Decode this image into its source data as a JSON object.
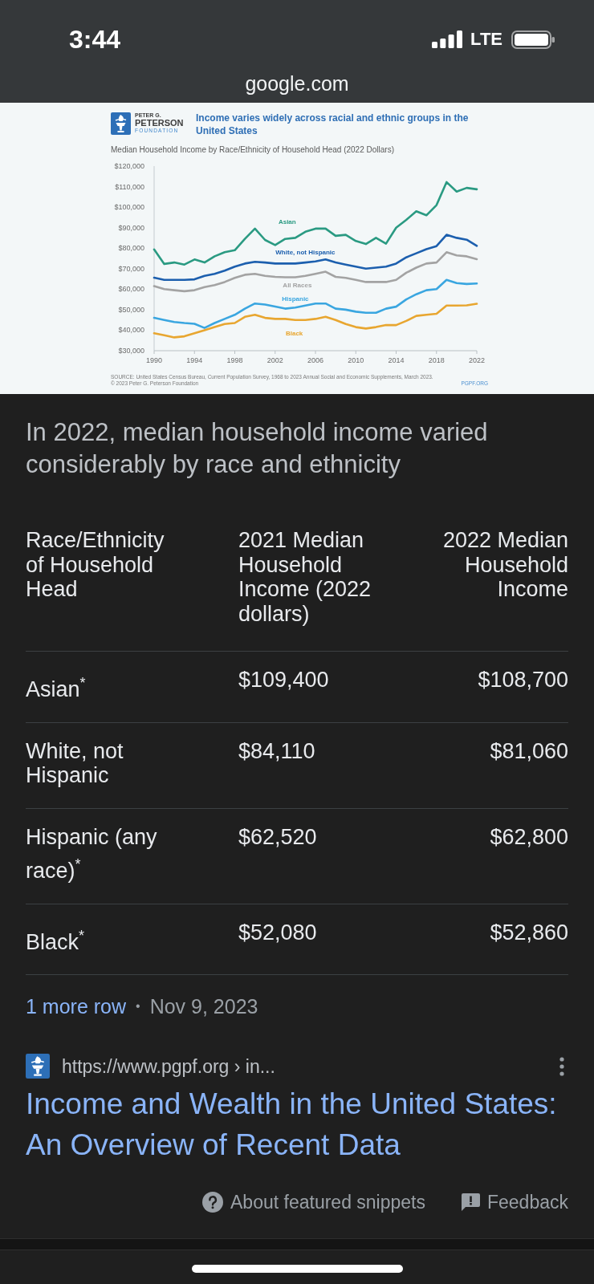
{
  "status_bar": {
    "time": "3:44",
    "network": "LTE"
  },
  "address_bar": {
    "url": "google.com"
  },
  "chart_image": {
    "logo": [
      "PETER G.",
      "PETERSON",
      "FOUNDATION"
    ],
    "subtitle": "Median Household Income by Race/Ethnicity of Household Head (2022 Dollars)",
    "chart_data": {
      "type": "line",
      "title": "Income varies widely across racial and ethnic groups in the United States",
      "x": [
        1990,
        1991,
        1992,
        1993,
        1994,
        1995,
        1996,
        1997,
        1998,
        1999,
        2000,
        2001,
        2002,
        2003,
        2004,
        2005,
        2006,
        2007,
        2008,
        2009,
        2010,
        2011,
        2012,
        2013,
        2014,
        2015,
        2016,
        2017,
        2018,
        2019,
        2020,
        2021,
        2022
      ],
      "series": [
        {
          "name": "Asian",
          "color": "#2a9a82",
          "values": [
            79400,
            72300,
            73000,
            72000,
            74500,
            73000,
            76000,
            78000,
            79000,
            84500,
            89500,
            84000,
            81500,
            84500,
            85000,
            88000,
            89500,
            89500,
            86000,
            86500,
            83500,
            82000,
            85000,
            82200,
            90000,
            93800,
            98000,
            96000,
            101000,
            112200,
            107600,
            109400,
            108700
          ]
        },
        {
          "name": "White, not Hispanic",
          "color": "#1c5fae",
          "values": [
            65600,
            64500,
            64500,
            64500,
            64800,
            66500,
            67500,
            69000,
            71000,
            72500,
            73300,
            73000,
            72500,
            72500,
            72500,
            73000,
            73500,
            74500,
            73000,
            72000,
            71000,
            70000,
            70500,
            71000,
            72500,
            75500,
            77500,
            79500,
            81000,
            86500,
            85000,
            84100,
            81100
          ]
        },
        {
          "name": "All Races",
          "color": "#a3a3a3",
          "values": [
            61500,
            60000,
            59500,
            59000,
            59500,
            61000,
            62000,
            63500,
            65500,
            67000,
            67500,
            66500,
            66000,
            65800,
            65800,
            66500,
            67500,
            68500,
            66000,
            65500,
            64500,
            63500,
            63500,
            63500,
            64500,
            68000,
            70500,
            72500,
            73000,
            78000,
            76500,
            76000,
            74600
          ]
        },
        {
          "name": "Hispanic",
          "color": "#3aa6e0",
          "values": [
            46000,
            45000,
            44000,
            43500,
            43100,
            41100,
            43500,
            45500,
            47500,
            50500,
            53000,
            52500,
            51500,
            50500,
            51000,
            52000,
            53000,
            53000,
            50500,
            50000,
            49000,
            48500,
            48500,
            50500,
            51500,
            55000,
            57500,
            59500,
            60000,
            64500,
            63000,
            62500,
            62800
          ]
        },
        {
          "name": "Black",
          "color": "#e8a630",
          "values": [
            38500,
            37500,
            36500,
            37000,
            38500,
            40000,
            41500,
            43000,
            43500,
            46500,
            47500,
            46000,
            45500,
            45500,
            45000,
            45000,
            45500,
            46500,
            45000,
            43000,
            41500,
            40800,
            41500,
            42500,
            42500,
            44500,
            47000,
            47500,
            48000,
            52000,
            52000,
            52100,
            52900
          ]
        }
      ],
      "xlim": [
        1990,
        2022
      ],
      "ylim": [
        30000,
        120000
      ],
      "xticks": [
        1990,
        1994,
        1998,
        2002,
        2006,
        2010,
        2014,
        2018,
        2022
      ],
      "yticks": [
        {
          "value": 30000,
          "label": "$30,000"
        },
        {
          "value": 40000,
          "label": "$40,000"
        },
        {
          "value": 50000,
          "label": "$50,000"
        },
        {
          "value": 60000,
          "label": "$60,000"
        },
        {
          "value": 70000,
          "label": "$70,000"
        },
        {
          "value": 80000,
          "label": "$80,000"
        },
        {
          "value": 90000,
          "label": "$90,000"
        },
        {
          "value": 100000,
          "label": "$100,000"
        },
        {
          "value": 110000,
          "label": "$110,000"
        },
        {
          "value": 120000,
          "label": "$120,000"
        }
      ]
    },
    "source": "SOURCE: United States Census Bureau, Current Population Survey, 1968 to 2023 Annual Social and Economic Supplements, March 2023.",
    "copyright": "© 2023 Peter G. Peterson Foundation",
    "site": "PGPF.ORG"
  },
  "snippet": {
    "heading": "In 2022, median household income varied considerably by race and ethnicity",
    "table": {
      "columns": [
        "Race/Ethnicity of Household Head",
        "2021 Median Household Income (2022 dollars)",
        "2022 Median Household Income"
      ],
      "rows": [
        [
          "Asian$^{*}$",
          "$109,400",
          "$108,700"
        ],
        [
          "White, not Hispanic",
          "$84,110",
          "$81,060"
        ],
        [
          "Hispanic (any race)$^{*}$",
          "$62,520",
          "$62,800"
        ],
        [
          "Black$^{*}$",
          "$52,080",
          "$52,860"
        ]
      ]
    },
    "more_rows": "1 more row",
    "separator": "•",
    "date": "Nov 9, 2023"
  },
  "result": {
    "url": "https://www.pgpf.org › in...",
    "title": "Income and Wealth in the United States: An Overview of Recent Data"
  },
  "footer": {
    "about": "About featured snippets",
    "feedback": "Feedback"
  }
}
